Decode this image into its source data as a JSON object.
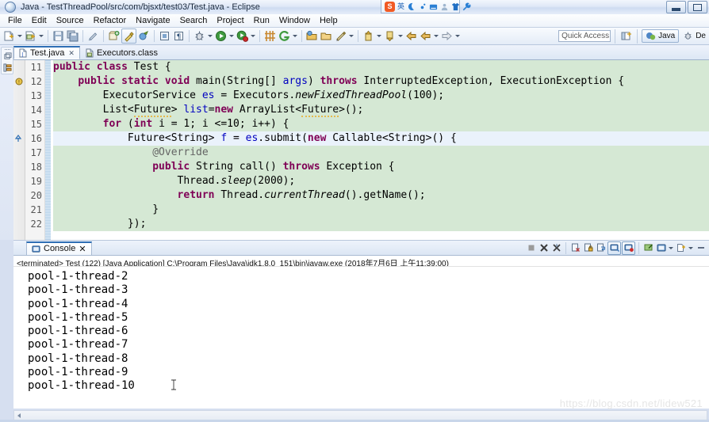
{
  "window": {
    "title": "Java - TestThreadPool/src/com/bjsxt/test03/Test.java - Eclipse",
    "icon": "eclipse-icon",
    "minimize_label": "Minimize",
    "restore_label": "Restore"
  },
  "ime": {
    "logo": "S",
    "mode": "英",
    "icons": [
      "moon-icon",
      "dot-icon",
      "keyboard-icon",
      "person-icon",
      "shirt-icon",
      "wrench-icon"
    ]
  },
  "menu": {
    "items": [
      {
        "label": "File"
      },
      {
        "label": "Edit"
      },
      {
        "label": "Source"
      },
      {
        "label": "Refactor"
      },
      {
        "label": "Navigate"
      },
      {
        "label": "Search"
      },
      {
        "label": "Project"
      },
      {
        "label": "Run"
      },
      {
        "label": "Window"
      },
      {
        "label": "Help"
      }
    ]
  },
  "toolbar": {
    "quick_access_placeholder": "Quick Access",
    "perspective_open_icon": "open-perspective-icon",
    "perspectives": [
      {
        "label": "Java",
        "icon": "java-perspective-icon",
        "active": true
      },
      {
        "label": "De",
        "icon": "debug-perspective-icon",
        "active": false
      }
    ],
    "buttons": [
      {
        "icon": "new-wizard-icon",
        "dropdown": true
      },
      {
        "icon": "new-java-class-icon",
        "dropdown": true
      },
      {
        "icon": "save-icon",
        "dropdown": false
      },
      {
        "icon": "save-all-icon",
        "dropdown": false
      },
      {
        "icon": "toggle-mark-occurrences-icon",
        "dropdown": false
      },
      {
        "icon": "new-java-package-icon",
        "dropdown": false
      },
      {
        "icon": "build-icon",
        "dropdown": false,
        "selected": true
      },
      {
        "icon": "skip-breakpoints-icon",
        "dropdown": false
      },
      {
        "icon": "open-type-icon",
        "dropdown": false
      },
      {
        "icon": "pilcrow-icon",
        "dropdown": false
      },
      {
        "icon": "debug-icon",
        "dropdown": true
      },
      {
        "icon": "run-icon",
        "dropdown": true
      },
      {
        "icon": "coverage-icon",
        "dropdown": true
      },
      {
        "icon": "new-java-project-icon",
        "dropdown": false
      },
      {
        "icon": "search-g-icon",
        "dropdown": true
      },
      {
        "icon": "open-task-icon",
        "dropdown": false
      },
      {
        "icon": "open-folder-icon",
        "dropdown": false
      },
      {
        "icon": "edit-pencil-icon",
        "dropdown": true
      },
      {
        "icon": "previous-annotation-icon",
        "dropdown": true
      },
      {
        "icon": "next-annotation-icon",
        "dropdown": true
      },
      {
        "icon": "back-icon",
        "dropdown": false
      },
      {
        "icon": "forward-left-icon",
        "dropdown": true
      },
      {
        "icon": "forward-icon",
        "dropdown": true
      }
    ]
  },
  "editor": {
    "tabs": [
      {
        "label": "Test.java",
        "icon": "java-file-icon",
        "active": true,
        "closable": true
      },
      {
        "label": "Executors.class",
        "icon": "class-file-icon",
        "active": false,
        "closable": false
      }
    ],
    "lines": [
      {
        "num": "11",
        "highlight": true,
        "fold": false,
        "marker": ""
      },
      {
        "num": "12",
        "highlight": true,
        "fold": true,
        "marker": ""
      },
      {
        "num": "13",
        "highlight": true,
        "fold": false,
        "marker": ""
      },
      {
        "num": "14",
        "highlight": true,
        "fold": false,
        "marker": "warning"
      },
      {
        "num": "15",
        "highlight": true,
        "fold": false,
        "marker": ""
      },
      {
        "num": "16",
        "highlight": false,
        "fold": true,
        "marker": "",
        "current": true
      },
      {
        "num": "17",
        "highlight": true,
        "fold": true,
        "marker": ""
      },
      {
        "num": "18",
        "highlight": true,
        "fold": false,
        "marker": "override"
      },
      {
        "num": "19",
        "highlight": true,
        "fold": false,
        "marker": ""
      },
      {
        "num": "20",
        "highlight": true,
        "fold": false,
        "marker": ""
      },
      {
        "num": "21",
        "highlight": true,
        "fold": false,
        "marker": ""
      },
      {
        "num": "22",
        "highlight": true,
        "fold": false,
        "marker": ""
      }
    ],
    "code": {
      "l11": "public class Test {",
      "l12": "    public static void main(String[] args) throws InterruptedException, ExecutionException {",
      "l13": "        ExecutorService es = Executors.newFixedThreadPool(100);",
      "l14": "        List<Future> list=new ArrayList<Future>();",
      "l15": "        for (int i = 1; i <=10; i++) {",
      "l16": "            Future<String> f = es.submit(new Callable<String>() {",
      "l17": "                @Override",
      "l18": "                public String call() throws Exception {",
      "l19": "                    Thread.sleep(2000);",
      "l20": "                    return Thread.currentThread().getName();",
      "l21": "                }",
      "l22": "            });"
    }
  },
  "console": {
    "tab_label": "Console",
    "tab_icon": "console-icon",
    "close_icon": "close-icon",
    "status": "<terminated> Test (122) [Java Application] C:\\Program Files\\Java\\jdk1.8.0_151\\bin\\javaw.exe (2018年7月6日 上午11:39:00)",
    "tools": [
      {
        "icon": "terminate-icon",
        "enabled": false
      },
      {
        "icon": "remove-launch-icon",
        "enabled": true
      },
      {
        "icon": "remove-all-terminated-icon",
        "enabled": true
      },
      {
        "icon": "clear-console-icon",
        "enabled": true
      },
      {
        "icon": "scroll-lock-icon",
        "enabled": true
      },
      {
        "icon": "word-wrap-icon",
        "enabled": true
      },
      {
        "icon": "show-console-on-output-icon",
        "enabled": true,
        "toggled": true
      },
      {
        "icon": "show-console-on-error-icon",
        "enabled": true,
        "toggled": true
      },
      {
        "icon": "pin-console-icon",
        "enabled": true
      },
      {
        "icon": "display-selected-console-icon",
        "enabled": true,
        "dropdown": true
      },
      {
        "icon": "open-console-icon",
        "enabled": true,
        "dropdown": true
      },
      {
        "icon": "minimize-view-icon",
        "enabled": true
      }
    ],
    "output": [
      "pool-1-thread-2",
      "pool-1-thread-3",
      "pool-1-thread-4",
      "pool-1-thread-5",
      "pool-1-thread-6",
      "pool-1-thread-7",
      "pool-1-thread-8",
      "pool-1-thread-9",
      "pool-1-thread-10"
    ]
  },
  "watermark": "https://blog.csdn.net/lidew521",
  "colors": {
    "keyword": "#7f0055",
    "string": "#2a00ff",
    "comment": "#3f7f5f",
    "annotation": "#646464",
    "highlight_block": "#d5e8d4",
    "current_line": "#eaf2fb",
    "accent": "#2f6fb5"
  }
}
